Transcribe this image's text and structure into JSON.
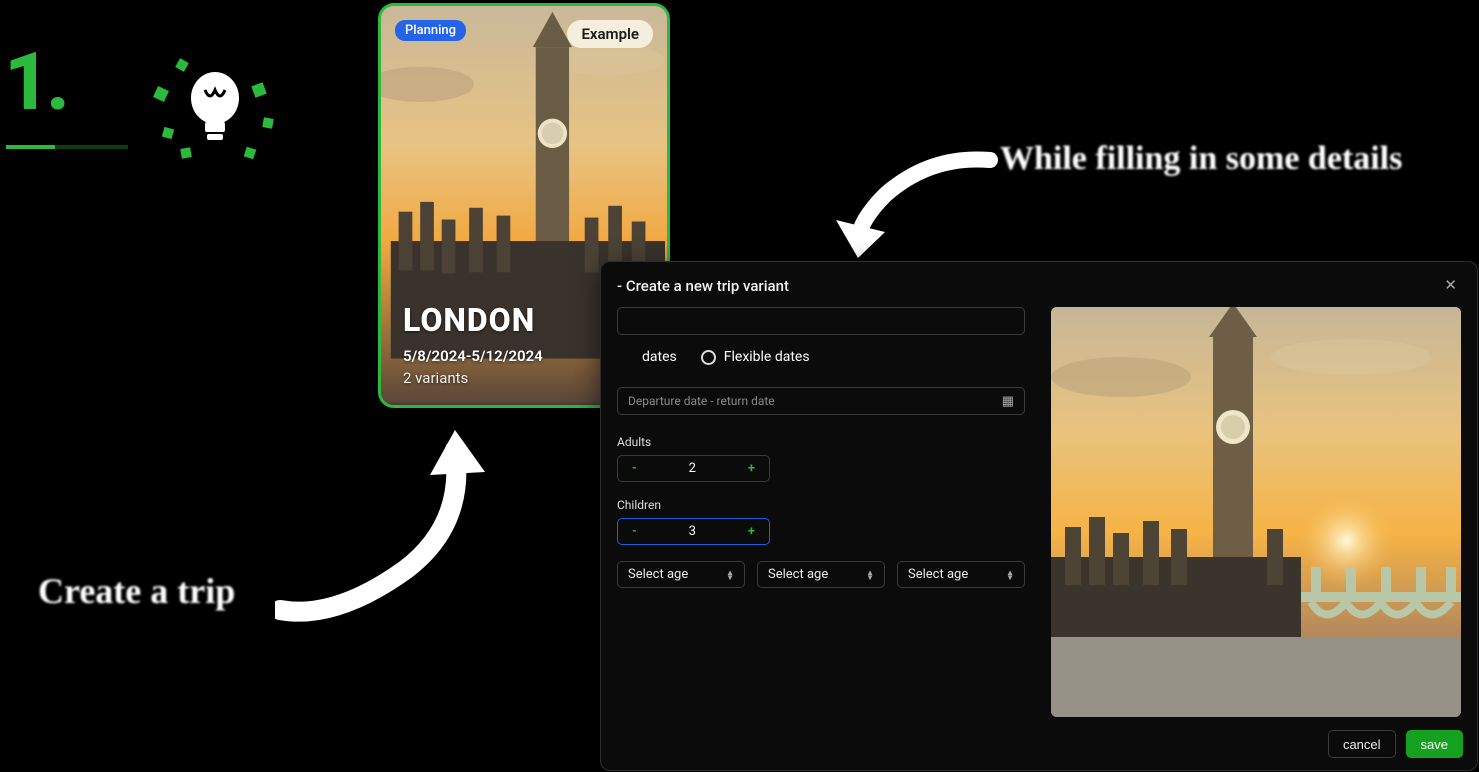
{
  "step": {
    "number": "1."
  },
  "captions": {
    "left": "Create a trip",
    "right": "While filling in some details"
  },
  "trip_card": {
    "planning_badge": "Planning",
    "example_badge": "Example",
    "title": "LONDON",
    "dates": "5/8/2024-5/12/2024",
    "variants": "2 variants"
  },
  "dialog": {
    "title": "- Create a new trip variant",
    "name_input": {
      "value": ""
    },
    "date_mode": {
      "exact_label": "dates",
      "flexible_label": "Flexible dates"
    },
    "date_range": {
      "placeholder": "Departure date - return date"
    },
    "adults": {
      "label": "Adults",
      "value": "2"
    },
    "children": {
      "label": "Children",
      "value": "3"
    },
    "age_placeholder": "Select age",
    "cancel": "cancel",
    "save": "save"
  },
  "colors": {
    "accent_green": "#2bba3e",
    "accent_blue": "#2563eb",
    "save_green": "#16a020"
  }
}
